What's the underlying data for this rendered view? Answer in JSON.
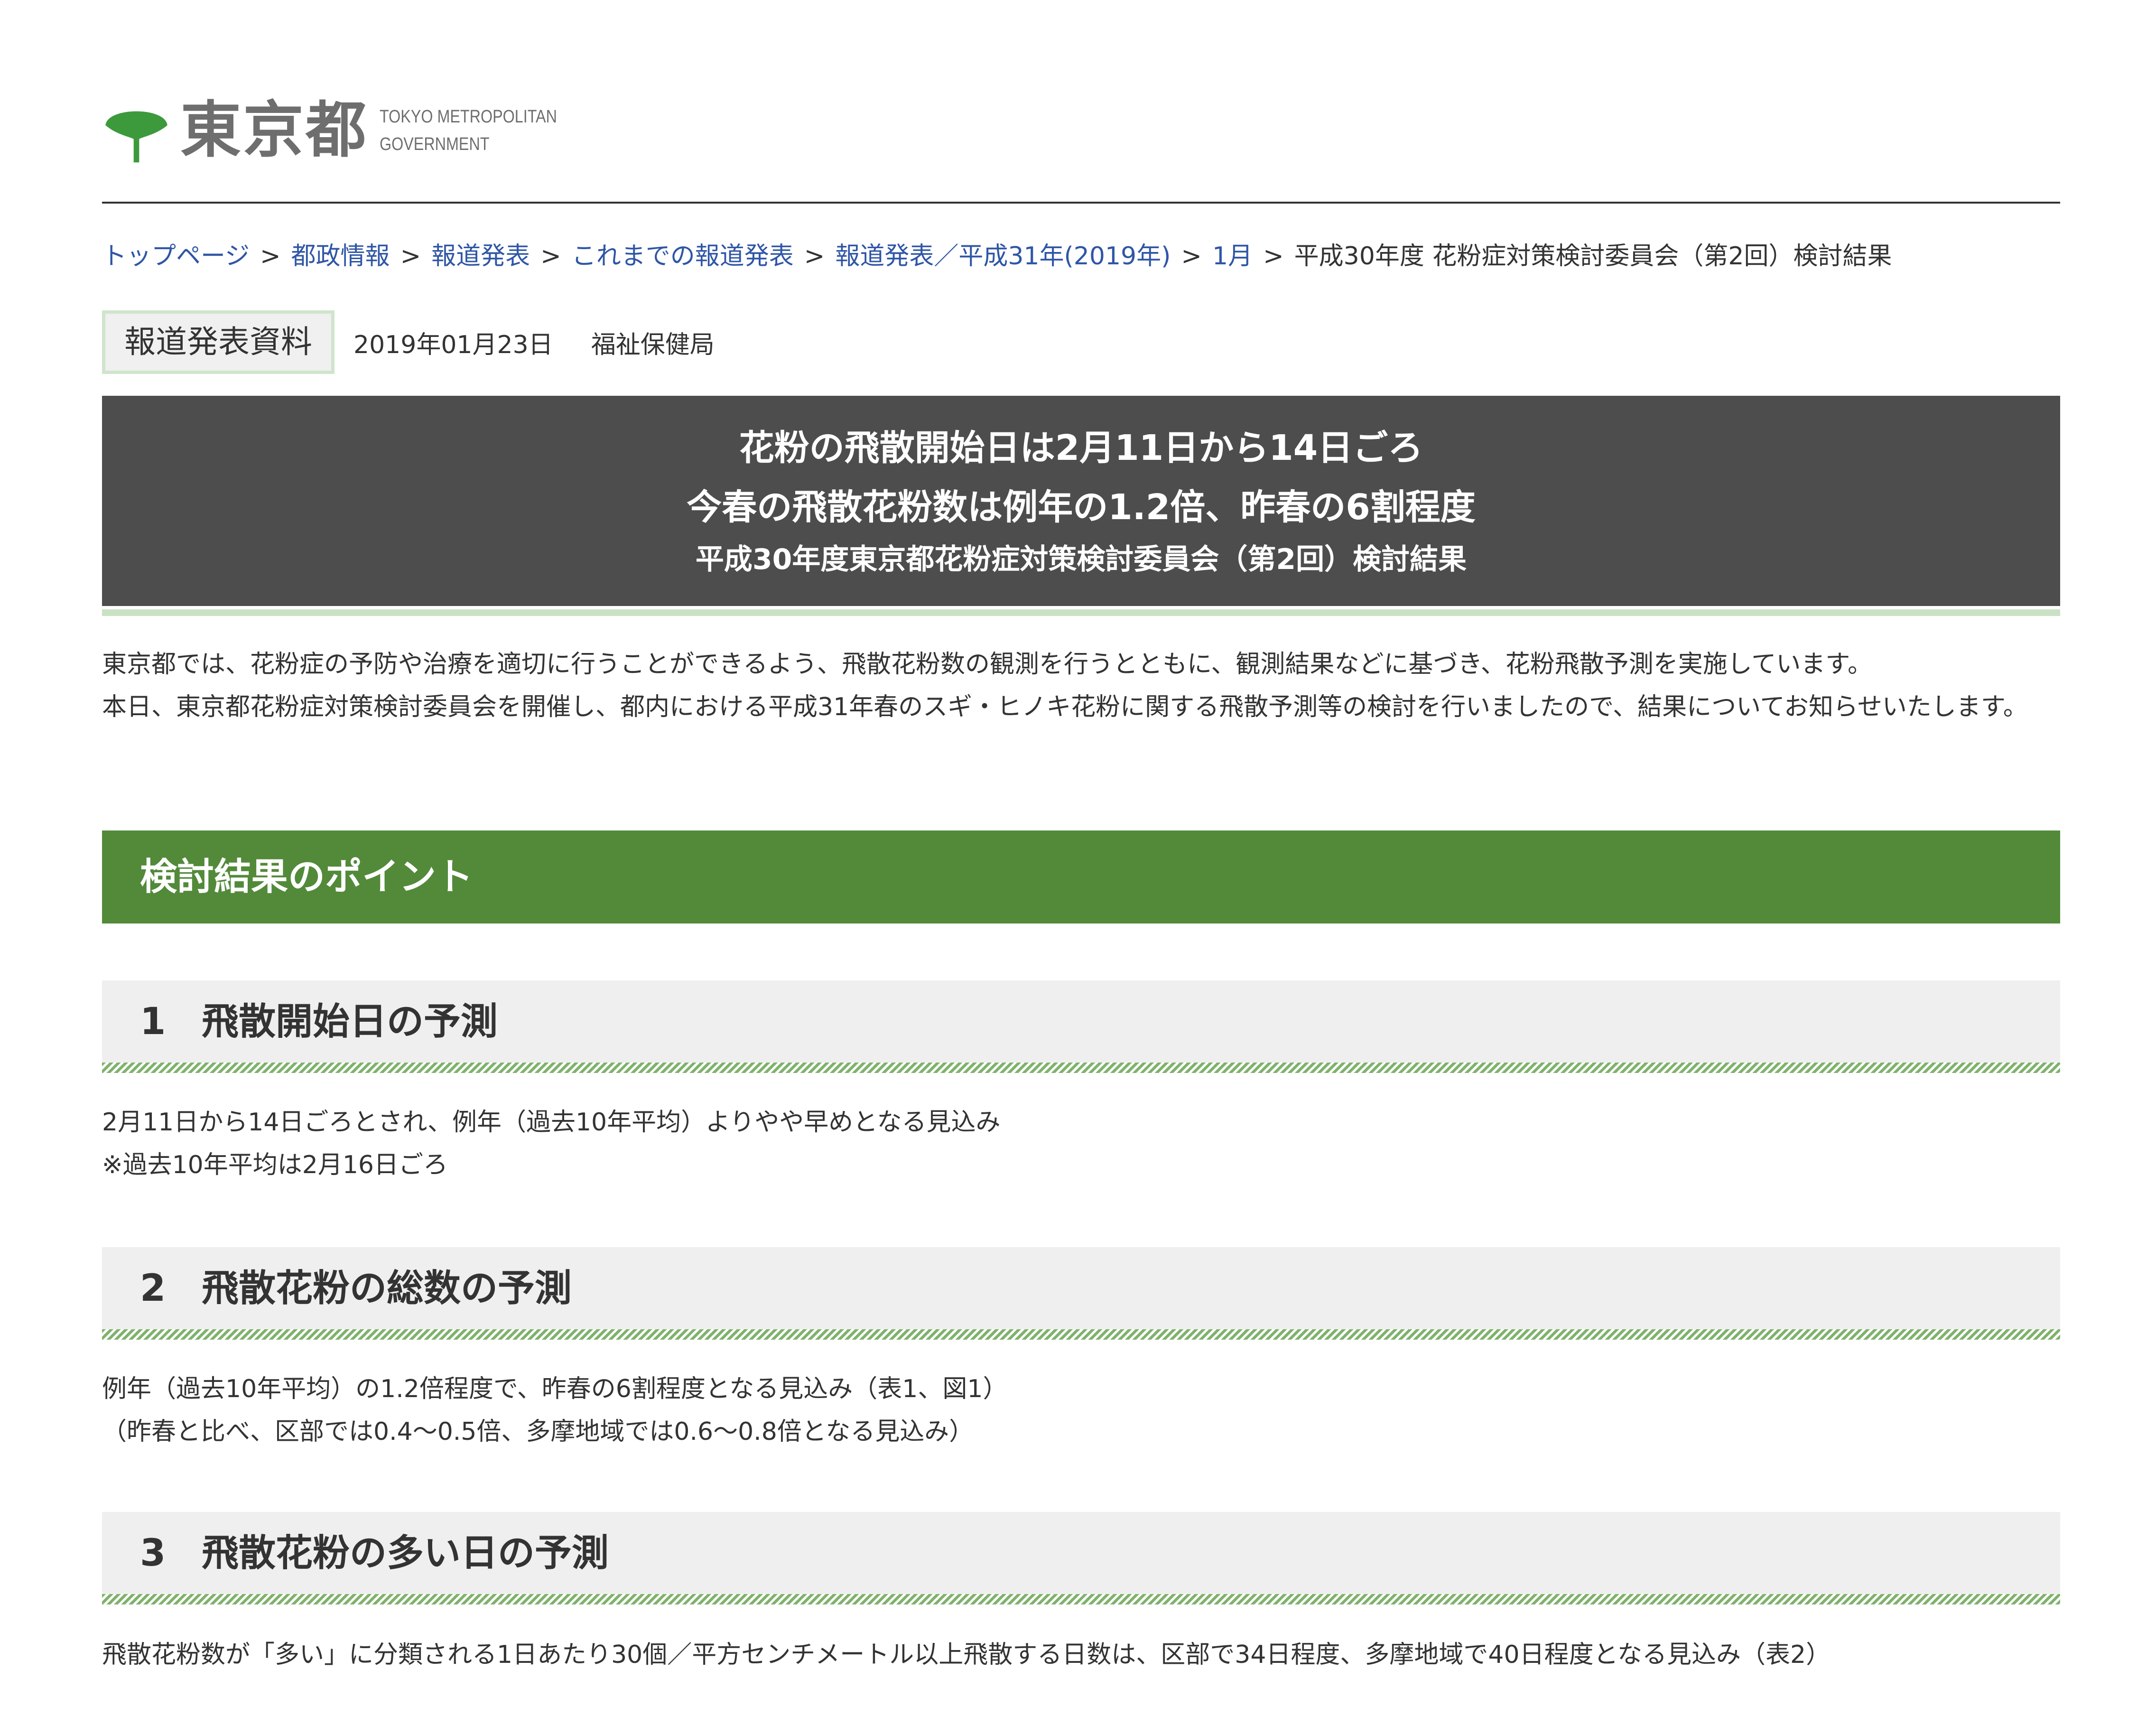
{
  "logo": {
    "kanji": "東京都",
    "english_line1": "TOKYO METROPOLITAN",
    "english_line2": "GOVERNMENT",
    "mark_color": "#3c9a3c"
  },
  "breadcrumb": {
    "items": [
      "トップページ",
      "都政情報",
      "報道発表",
      "これまでの報道発表",
      "報道発表／平成31年(2019年)",
      "1月"
    ],
    "separator": ">",
    "current": "平成30年度 花粉症対策検討委員会（第2回）検討結果"
  },
  "meta": {
    "badge": "報道発表資料",
    "date": "2019年01月23日",
    "bureau": "福祉保健局"
  },
  "headline": {
    "line1": "花粉の飛散開始日は2月11日から14日ごろ",
    "line2": "今春の飛散花粉数は例年の1.2倍、昨春の6割程度",
    "line3": "平成30年度東京都花粉症対策検討委員会（第2回）検討結果"
  },
  "intro": {
    "p1": "東京都では、花粉症の予防や治療を適切に行うことができるよう、飛散花粉数の観測を行うとともに、観測結果などに基づき、花粉飛散予測を実施しています。",
    "p2": "本日、東京都花粉症対策検討委員会を開催し、都内における平成31年春のスギ・ヒノキ花粉に関する飛散予測等の検討を行いましたので、結果についてお知らせいたします。"
  },
  "points": {
    "title": "検討結果のポイント"
  },
  "sections": [
    {
      "num": "1",
      "title": "飛散開始日の予測",
      "lines": [
        "2月11日から14日ごろとされ、例年（過去10年平均）よりやや早めとなる見込み",
        "※過去10年平均は2月16日ごろ"
      ]
    },
    {
      "num": "2",
      "title": "飛散花粉の総数の予測",
      "lines": [
        "例年（過去10年平均）の1.2倍程度で、昨春の6割程度となる見込み（表1、図1）",
        "（昨春と比べ、区部では0.4～0.5倍、多摩地域では0.6～0.8倍となる見込み）"
      ]
    },
    {
      "num": "3",
      "title": "飛散花粉の多い日の予測",
      "lines": [
        "飛散花粉数が「多い」に分類される1日あたり30個／平方センチメートル以上飛散する日数は、区部で34日程度、多摩地域で40日程度となる見込み（表2）"
      ]
    }
  ],
  "colors": {
    "link": "#2f56a6",
    "headline_bg": "#4d4d4d",
    "green_bar": "#528a3a",
    "stripe": "#7fb26c",
    "sub_bg": "#efefef"
  }
}
